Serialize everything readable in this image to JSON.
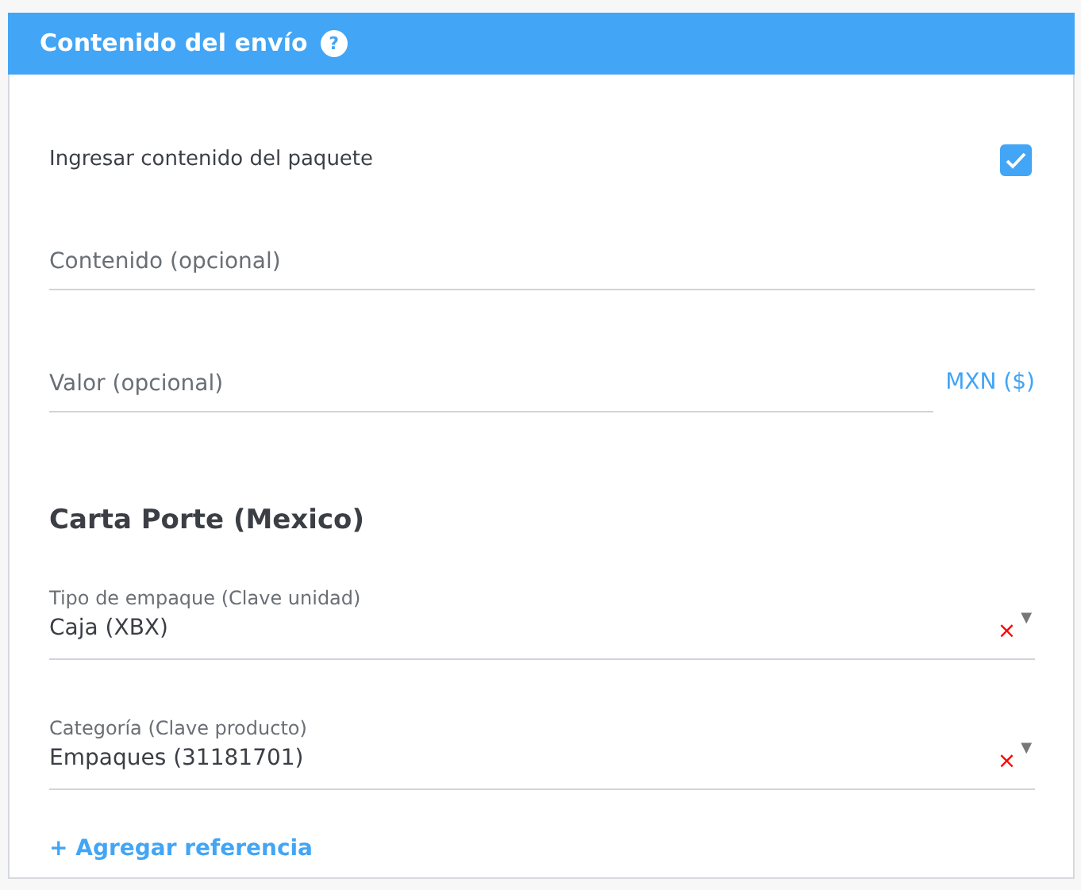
{
  "panel": {
    "title": "Contenido del envío",
    "help_icon": "?"
  },
  "checkbox": {
    "label": "Ingresar contenido del paquete",
    "checked": true
  },
  "fields": [
    {
      "placeholder": "Contenido (opcional)"
    },
    {
      "placeholder": "Valor (opcional)",
      "suffix": "MXN ($)"
    }
  ],
  "section_title": "Carta Porte (Mexico)",
  "selects": [
    {
      "label": "Tipo de empaque (Clave unidad)",
      "value": "Caja (XBX)",
      "clear": "×",
      "caret": "▼"
    },
    {
      "label": "Categoría (Clave producto)",
      "value": "Empaques (31181701)",
      "clear": "×",
      "caret": "▼"
    }
  ],
  "link": "+ Agregar referencia"
}
